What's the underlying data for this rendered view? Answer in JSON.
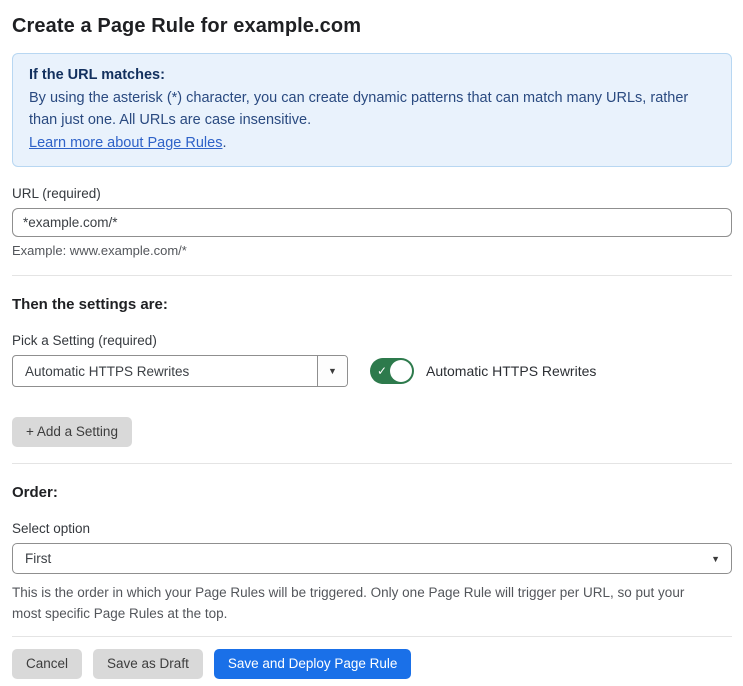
{
  "page": {
    "title": "Create a Page Rule for example.com"
  },
  "info_box": {
    "heading": "If the URL matches:",
    "body": "By using the asterisk (*) character, you can create dynamic patterns that can match many URLs, rather than just one. All URLs are case insensitive.",
    "link_label": "Learn more about Page Rules",
    "link_suffix": "."
  },
  "url_field": {
    "label": "URL (required)",
    "value": "*example.com/*",
    "helper": "Example: www.example.com/*"
  },
  "settings_section": {
    "heading": "Then the settings are:",
    "picker_label": "Pick a Setting (required)",
    "picker_value": "Automatic HTTPS Rewrites",
    "toggle": {
      "state": "on",
      "label": "Automatic HTTPS Rewrites"
    },
    "add_button_label": "+ Add a Setting"
  },
  "order_section": {
    "heading": "Order:",
    "select_label": "Select option",
    "select_value": "First",
    "helper": "This is the order in which your Page Rules will be triggered. Only one Page Rule will trigger per URL, so put your most specific Page Rules at the top."
  },
  "footer": {
    "cancel_label": "Cancel",
    "save_draft_label": "Save as Draft",
    "save_deploy_label": "Save and Deploy Page Rule"
  },
  "icons": {
    "caret_down": "▼",
    "check": "✓"
  },
  "colors": {
    "accent_blue": "#1a70e8",
    "info_bg": "#e9f2fc",
    "info_border": "#b8d7f2",
    "info_heading": "#12305e",
    "info_text": "#2a4a80",
    "link_blue": "#2e62c8",
    "toggle_green": "#2d7a4c",
    "border_gray": "#8f8f8f",
    "divider": "#e4e4e4",
    "btn_gray": "#d9d9d9"
  }
}
